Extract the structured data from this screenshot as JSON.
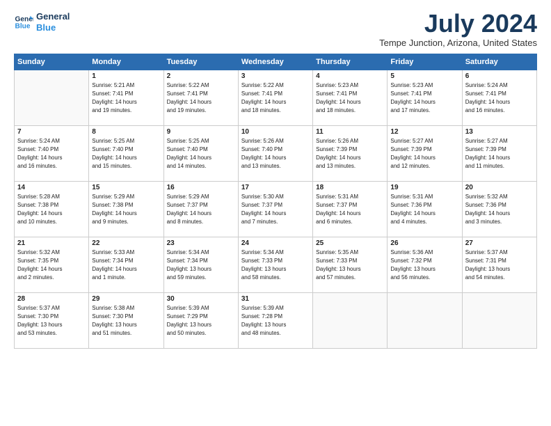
{
  "logo": {
    "line1": "General",
    "line2": "Blue"
  },
  "title": "July 2024",
  "location": "Tempe Junction, Arizona, United States",
  "weekdays": [
    "Sunday",
    "Monday",
    "Tuesday",
    "Wednesday",
    "Thursday",
    "Friday",
    "Saturday"
  ],
  "weeks": [
    [
      {
        "day": "",
        "info": ""
      },
      {
        "day": "1",
        "info": "Sunrise: 5:21 AM\nSunset: 7:41 PM\nDaylight: 14 hours\nand 19 minutes."
      },
      {
        "day": "2",
        "info": "Sunrise: 5:22 AM\nSunset: 7:41 PM\nDaylight: 14 hours\nand 19 minutes."
      },
      {
        "day": "3",
        "info": "Sunrise: 5:22 AM\nSunset: 7:41 PM\nDaylight: 14 hours\nand 18 minutes."
      },
      {
        "day": "4",
        "info": "Sunrise: 5:23 AM\nSunset: 7:41 PM\nDaylight: 14 hours\nand 18 minutes."
      },
      {
        "day": "5",
        "info": "Sunrise: 5:23 AM\nSunset: 7:41 PM\nDaylight: 14 hours\nand 17 minutes."
      },
      {
        "day": "6",
        "info": "Sunrise: 5:24 AM\nSunset: 7:41 PM\nDaylight: 14 hours\nand 16 minutes."
      }
    ],
    [
      {
        "day": "7",
        "info": "Sunrise: 5:24 AM\nSunset: 7:40 PM\nDaylight: 14 hours\nand 16 minutes."
      },
      {
        "day": "8",
        "info": "Sunrise: 5:25 AM\nSunset: 7:40 PM\nDaylight: 14 hours\nand 15 minutes."
      },
      {
        "day": "9",
        "info": "Sunrise: 5:25 AM\nSunset: 7:40 PM\nDaylight: 14 hours\nand 14 minutes."
      },
      {
        "day": "10",
        "info": "Sunrise: 5:26 AM\nSunset: 7:40 PM\nDaylight: 14 hours\nand 13 minutes."
      },
      {
        "day": "11",
        "info": "Sunrise: 5:26 AM\nSunset: 7:39 PM\nDaylight: 14 hours\nand 13 minutes."
      },
      {
        "day": "12",
        "info": "Sunrise: 5:27 AM\nSunset: 7:39 PM\nDaylight: 14 hours\nand 12 minutes."
      },
      {
        "day": "13",
        "info": "Sunrise: 5:27 AM\nSunset: 7:39 PM\nDaylight: 14 hours\nand 11 minutes."
      }
    ],
    [
      {
        "day": "14",
        "info": "Sunrise: 5:28 AM\nSunset: 7:38 PM\nDaylight: 14 hours\nand 10 minutes."
      },
      {
        "day": "15",
        "info": "Sunrise: 5:29 AM\nSunset: 7:38 PM\nDaylight: 14 hours\nand 9 minutes."
      },
      {
        "day": "16",
        "info": "Sunrise: 5:29 AM\nSunset: 7:37 PM\nDaylight: 14 hours\nand 8 minutes."
      },
      {
        "day": "17",
        "info": "Sunrise: 5:30 AM\nSunset: 7:37 PM\nDaylight: 14 hours\nand 7 minutes."
      },
      {
        "day": "18",
        "info": "Sunrise: 5:31 AM\nSunset: 7:37 PM\nDaylight: 14 hours\nand 6 minutes."
      },
      {
        "day": "19",
        "info": "Sunrise: 5:31 AM\nSunset: 7:36 PM\nDaylight: 14 hours\nand 4 minutes."
      },
      {
        "day": "20",
        "info": "Sunrise: 5:32 AM\nSunset: 7:36 PM\nDaylight: 14 hours\nand 3 minutes."
      }
    ],
    [
      {
        "day": "21",
        "info": "Sunrise: 5:32 AM\nSunset: 7:35 PM\nDaylight: 14 hours\nand 2 minutes."
      },
      {
        "day": "22",
        "info": "Sunrise: 5:33 AM\nSunset: 7:34 PM\nDaylight: 14 hours\nand 1 minute."
      },
      {
        "day": "23",
        "info": "Sunrise: 5:34 AM\nSunset: 7:34 PM\nDaylight: 13 hours\nand 59 minutes."
      },
      {
        "day": "24",
        "info": "Sunrise: 5:34 AM\nSunset: 7:33 PM\nDaylight: 13 hours\nand 58 minutes."
      },
      {
        "day": "25",
        "info": "Sunrise: 5:35 AM\nSunset: 7:33 PM\nDaylight: 13 hours\nand 57 minutes."
      },
      {
        "day": "26",
        "info": "Sunrise: 5:36 AM\nSunset: 7:32 PM\nDaylight: 13 hours\nand 56 minutes."
      },
      {
        "day": "27",
        "info": "Sunrise: 5:37 AM\nSunset: 7:31 PM\nDaylight: 13 hours\nand 54 minutes."
      }
    ],
    [
      {
        "day": "28",
        "info": "Sunrise: 5:37 AM\nSunset: 7:30 PM\nDaylight: 13 hours\nand 53 minutes."
      },
      {
        "day": "29",
        "info": "Sunrise: 5:38 AM\nSunset: 7:30 PM\nDaylight: 13 hours\nand 51 minutes."
      },
      {
        "day": "30",
        "info": "Sunrise: 5:39 AM\nSunset: 7:29 PM\nDaylight: 13 hours\nand 50 minutes."
      },
      {
        "day": "31",
        "info": "Sunrise: 5:39 AM\nSunset: 7:28 PM\nDaylight: 13 hours\nand 48 minutes."
      },
      {
        "day": "",
        "info": ""
      },
      {
        "day": "",
        "info": ""
      },
      {
        "day": "",
        "info": ""
      }
    ]
  ]
}
